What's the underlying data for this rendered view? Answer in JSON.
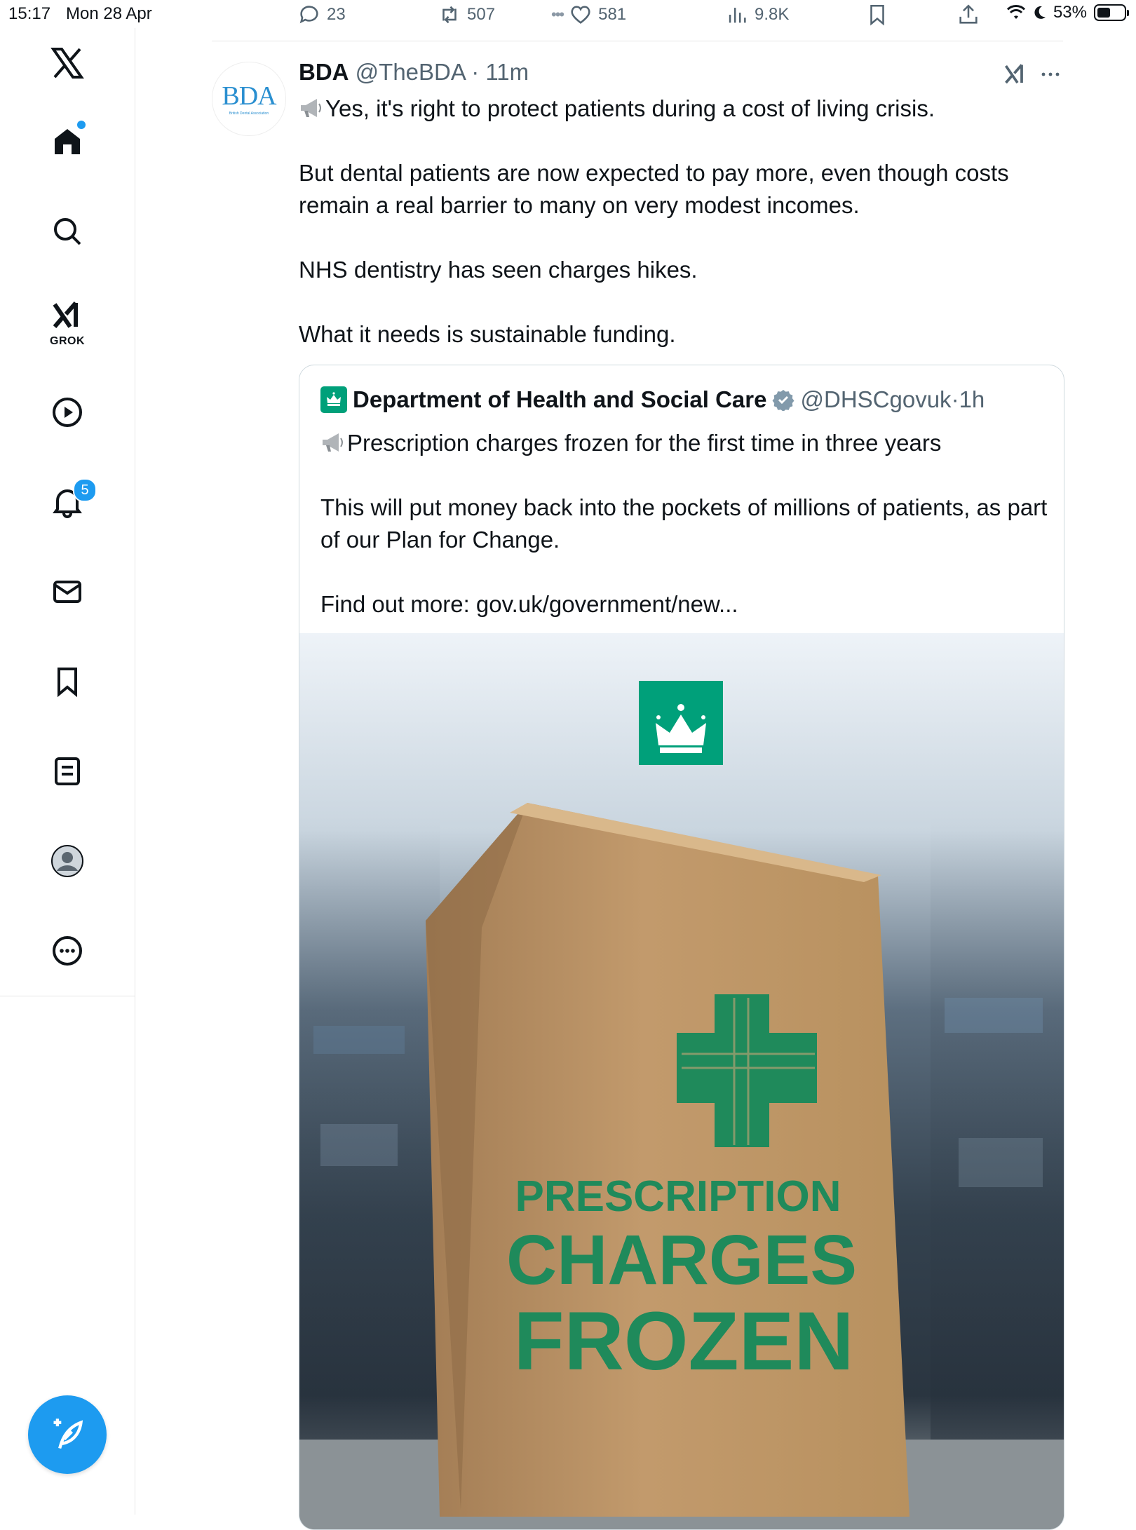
{
  "status_bar": {
    "time": "15:17",
    "date": "Mon 28 Apr",
    "battery": "53%",
    "battery_level": 0.53
  },
  "engagement_bar": {
    "replies": "23",
    "reposts": "507",
    "likes": "581",
    "views": "9.8K"
  },
  "sidebar": {
    "grok_label": "GROK",
    "notifications_badge": "5",
    "items": [
      "x-logo",
      "home-icon",
      "search-icon",
      "grok-icon",
      "video-icon",
      "bell-icon",
      "mail-icon",
      "bookmark-icon",
      "lists-icon",
      "profile-icon",
      "more-icon"
    ]
  },
  "tweet": {
    "name": "BDA",
    "handle": "@TheBDA",
    "time": "11m",
    "avatar_text": "BDA",
    "avatar_subtext": "British Dental Association",
    "paragraphs": [
      "Yes, it's right to protect patients during a cost of living crisis.",
      "But dental patients are now expected to pay more, even though costs remain a real barrier to many on very modest incomes.",
      "NHS dentistry has seen charges hikes.",
      "What it needs is sustainable funding."
    ]
  },
  "quote": {
    "name": "Department of Health and Social Care",
    "handle": "@DHSCgovuk",
    "time": "1h",
    "paragraphs": [
      "Prescription charges frozen for the first time in three years",
      "This will put money back into the pockets of millions of patients, as part of our Plan for Change.",
      "Find out more: gov.uk/government/new..."
    ],
    "image": {
      "bag_line1": "PRESCRIPTION",
      "bag_line2": "CHARGES",
      "bag_line3": "FROZEN",
      "accent_color": "#1f8a5b",
      "logo_color": "#00a07a"
    }
  }
}
